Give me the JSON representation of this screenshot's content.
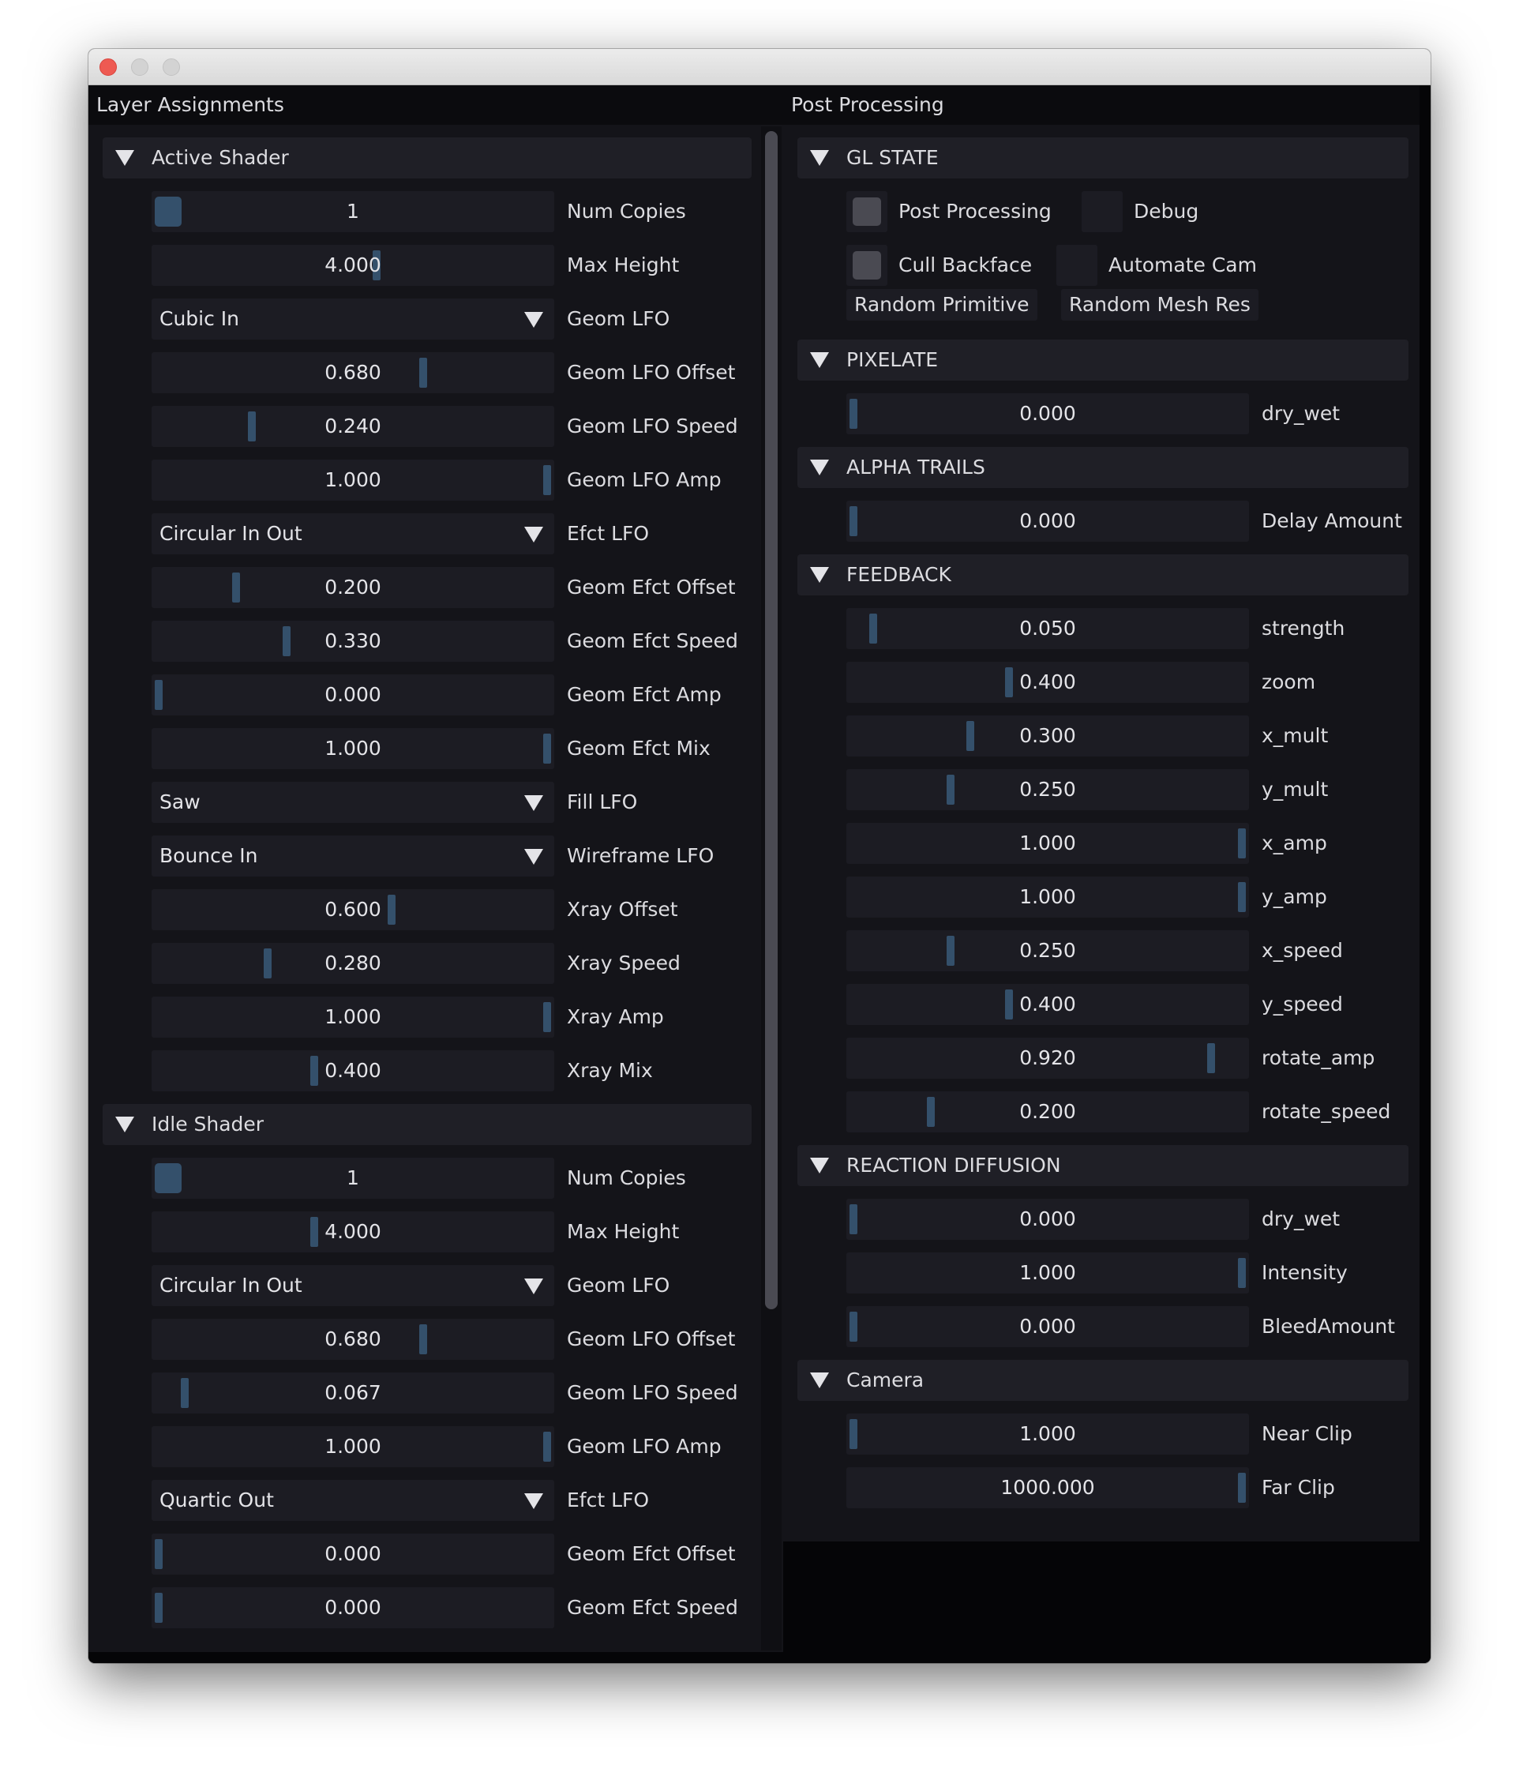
{
  "window": {
    "controls": {
      "close": "close-button",
      "minimize": "minimize-button",
      "zoom": "zoom-button"
    }
  },
  "layer_panel": {
    "title": "Layer Assignments",
    "sections": [
      {
        "title": "Active Shader",
        "rows": [
          {
            "type": "int",
            "value": "1",
            "label": "Num Copies",
            "fill": 0.0
          },
          {
            "type": "slider",
            "value": "4.000",
            "label": "Max Height",
            "fill": 0.56
          },
          {
            "type": "combo",
            "value": "Cubic In",
            "label": "Geom LFO"
          },
          {
            "type": "slider",
            "value": "0.680",
            "label": "Geom LFO Offset",
            "fill": 0.68
          },
          {
            "type": "slider",
            "value": "0.240",
            "label": "Geom LFO Speed",
            "fill": 0.24
          },
          {
            "type": "slider",
            "value": "1.000",
            "label": "Geom LFO Amp",
            "fill": 1.0
          },
          {
            "type": "combo",
            "value": "Circular In Out",
            "label": "Efct LFO"
          },
          {
            "type": "slider",
            "value": "0.200",
            "label": "Geom Efct Offset",
            "fill": 0.2
          },
          {
            "type": "slider",
            "value": "0.330",
            "label": "Geom Efct Speed",
            "fill": 0.33
          },
          {
            "type": "slider",
            "value": "0.000",
            "label": "Geom Efct Amp",
            "fill": 0.0
          },
          {
            "type": "slider",
            "value": "1.000",
            "label": "Geom Efct Mix",
            "fill": 1.0
          },
          {
            "type": "combo",
            "value": "Saw",
            "label": "Fill LFO"
          },
          {
            "type": "combo",
            "value": "Bounce In",
            "label": "Wireframe LFO"
          },
          {
            "type": "slider",
            "value": "0.600",
            "label": "Xray Offset",
            "fill": 0.6
          },
          {
            "type": "slider",
            "value": "0.280",
            "label": "Xray Speed",
            "fill": 0.28
          },
          {
            "type": "slider",
            "value": "1.000",
            "label": "Xray Amp",
            "fill": 1.0
          },
          {
            "type": "slider",
            "value": "0.400",
            "label": "Xray Mix",
            "fill": 0.4
          }
        ]
      },
      {
        "title": "Idle Shader",
        "rows": [
          {
            "type": "int",
            "value": "1",
            "label": "Num Copies",
            "fill": 0.0
          },
          {
            "type": "slider",
            "value": "4.000",
            "label": "Max Height",
            "fill": 0.4
          },
          {
            "type": "combo",
            "value": "Circular In Out",
            "label": "Geom LFO"
          },
          {
            "type": "slider",
            "value": "0.680",
            "label": "Geom LFO Offset",
            "fill": 0.68
          },
          {
            "type": "slider",
            "value": "0.067",
            "label": "Geom LFO Speed",
            "fill": 0.067
          },
          {
            "type": "slider",
            "value": "1.000",
            "label": "Geom LFO Amp",
            "fill": 1.0
          },
          {
            "type": "combo",
            "value": "Quartic Out",
            "label": "Efct LFO"
          },
          {
            "type": "slider",
            "value": "0.000",
            "label": "Geom Efct Offset",
            "fill": 0.0
          },
          {
            "type": "slider",
            "value": "0.000",
            "label": "Geom Efct Speed",
            "fill": 0.0
          }
        ]
      }
    ]
  },
  "post_panel": {
    "title": "Post Processing",
    "gl_state": {
      "title": "GL STATE",
      "checkboxes": [
        {
          "label": "Post Processing",
          "checked": false
        },
        {
          "label": "Debug",
          "checked": false
        },
        {
          "label": "Cull Backface",
          "checked": false
        },
        {
          "label": "Automate Cam",
          "checked": false
        }
      ],
      "buttons": [
        "Random Primitive",
        "Random Mesh Res"
      ]
    },
    "sections": [
      {
        "title": "PIXELATE",
        "rows": [
          {
            "type": "slider",
            "value": "0.000",
            "label": "dry_wet",
            "fill": 0.0
          }
        ]
      },
      {
        "title": "ALPHA TRAILS",
        "rows": [
          {
            "type": "slider",
            "value": "0.000",
            "label": "Delay Amount",
            "fill": 0.0
          }
        ]
      },
      {
        "title": "FEEDBACK",
        "rows": [
          {
            "type": "slider",
            "value": "0.050",
            "label": "strength",
            "fill": 0.05
          },
          {
            "type": "slider",
            "value": "0.400",
            "label": "zoom",
            "fill": 0.4
          },
          {
            "type": "slider",
            "value": "0.300",
            "label": "x_mult",
            "fill": 0.3
          },
          {
            "type": "slider",
            "value": "0.250",
            "label": "y_mult",
            "fill": 0.25
          },
          {
            "type": "slider",
            "value": "1.000",
            "label": "x_amp",
            "fill": 1.0
          },
          {
            "type": "slider",
            "value": "1.000",
            "label": "y_amp",
            "fill": 1.0
          },
          {
            "type": "slider",
            "value": "0.250",
            "label": "x_speed",
            "fill": 0.25
          },
          {
            "type": "slider",
            "value": "0.400",
            "label": "y_speed",
            "fill": 0.4
          },
          {
            "type": "slider",
            "value": "0.920",
            "label": "rotate_amp",
            "fill": 0.92
          },
          {
            "type": "slider",
            "value": "0.200",
            "label": "rotate_speed",
            "fill": 0.2
          }
        ]
      },
      {
        "title": "REACTION DIFFUSION",
        "rows": [
          {
            "type": "slider",
            "value": "0.000",
            "label": "dry_wet",
            "fill": 0.0
          },
          {
            "type": "slider",
            "value": "1.000",
            "label": "Intensity",
            "fill": 1.0
          },
          {
            "type": "slider",
            "value": "0.000",
            "label": "BleedAmount",
            "fill": 0.0
          }
        ]
      },
      {
        "title": "Camera",
        "rows": [
          {
            "type": "slider",
            "value": "1.000",
            "label": "Near Clip",
            "fill": 0.0
          },
          {
            "type": "slider",
            "value": "1000.000",
            "label": "Far Clip",
            "fill": 1.0
          }
        ]
      }
    ]
  },
  "colors": {
    "background": "#050507",
    "panel": "#141419",
    "frame": "#1c1c23",
    "header": "#1f1f26",
    "grab": "#34506b",
    "checkbox": "#4a4a52",
    "text": "#dcdce0"
  }
}
